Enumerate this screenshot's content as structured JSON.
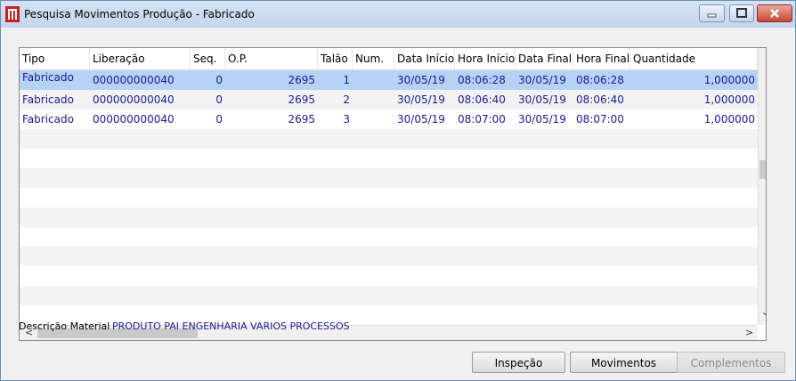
{
  "window": {
    "title": "Pesquisa Movimentos Produção - Fabricado"
  },
  "grid": {
    "columns": [
      "Tipo",
      "Liberação",
      "Seq.",
      "O.P.",
      "Talão",
      "Num.",
      "Data Início",
      "Hora Início",
      "Data Final",
      "Hora Final",
      "Quantidade"
    ],
    "rows": [
      {
        "tipo": "Fabricado",
        "liberacao": "000000000040",
        "seq": "0",
        "op": "2695",
        "talao": "1",
        "num": "",
        "data_inicio": "30/05/19",
        "hora_inicio": "08:06:28",
        "data_final": "30/05/19",
        "hora_final": "08:06:28",
        "quantidade": "1,000000"
      },
      {
        "tipo": "Fabricado",
        "liberacao": "000000000040",
        "seq": "0",
        "op": "2695",
        "talao": "2",
        "num": "",
        "data_inicio": "30/05/19",
        "hora_inicio": "08:06:40",
        "data_final": "30/05/19",
        "hora_final": "08:06:40",
        "quantidade": "1,000000"
      },
      {
        "tipo": "Fabricado",
        "liberacao": "000000000040",
        "seq": "0",
        "op": "2695",
        "talao": "3",
        "num": "",
        "data_inicio": "30/05/19",
        "hora_inicio": "08:07:00",
        "data_final": "30/05/19",
        "hora_final": "08:07:00",
        "quantidade": "1,000000"
      }
    ],
    "selected_row": 0
  },
  "material": {
    "label": "Descrição Material",
    "value": "PRODUTO PAI ENGENHARIA VARIOS PROCESSOS"
  },
  "buttons": {
    "inspecao": "Inspeção",
    "movimentos": "Movimentos",
    "complementos": "Complementos"
  },
  "scroll": {
    "left_arrow": "<",
    "right_arrow": ">",
    "down_arrow": "⌄"
  }
}
